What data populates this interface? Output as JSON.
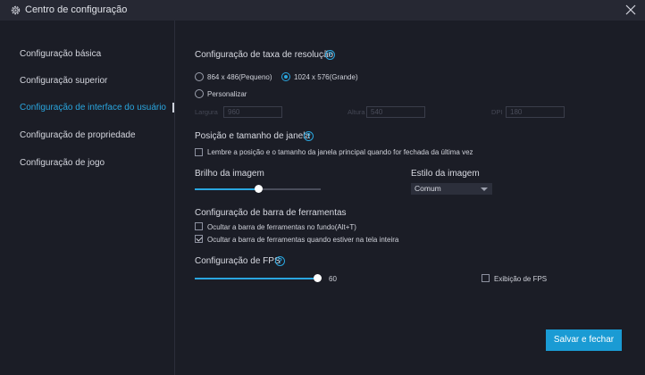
{
  "window": {
    "title": "Centro de configuração",
    "icon": "gear-icon",
    "close_icon": "close-icon"
  },
  "sidebar": {
    "items": [
      {
        "label": "Configuração básica",
        "active": false
      },
      {
        "label": "Configuração superior",
        "active": false
      },
      {
        "label": "Configuração de interface do usuário",
        "active": true
      },
      {
        "label": "Configuração de propriedade",
        "active": false
      },
      {
        "label": "Configuração de jogo",
        "active": false
      }
    ]
  },
  "resolution": {
    "title": "Configuração de taxa de resolução",
    "options": [
      {
        "label": "864 x 486(Pequeno)",
        "selected": false
      },
      {
        "label": "1024 x 576(Grande)",
        "selected": true
      },
      {
        "label": "Personalizar",
        "selected": false
      }
    ],
    "fields": [
      {
        "label": "Largura",
        "value": "960"
      },
      {
        "label": "Altura",
        "value": "540"
      },
      {
        "label": "DPI",
        "value": "180"
      }
    ]
  },
  "position": {
    "title": "Posição e tamanho de janela",
    "remember_label": "Lembre a posição e o tamanho da janela principal quando for fechada da última vez",
    "remember_checked": false
  },
  "brightness": {
    "title": "Brilho da imagem",
    "level_fraction": 0.5
  },
  "image_style": {
    "title": "Estilo da imagem",
    "selected": "Comum"
  },
  "toolbar": {
    "title": "Configuração de barra de ferramentas",
    "options": [
      {
        "label": "Ocultar a barra de ferramentas no fundo(Alt+T)",
        "checked": false
      },
      {
        "label": "Ocultar a barra de ferramentas quando estiver na tela inteira",
        "checked": true
      }
    ]
  },
  "fps": {
    "title": "Configuração de FPS",
    "value": "60",
    "level_fraction": 1.0,
    "show_label": "Exibição de FPS",
    "show_checked": false
  },
  "footer": {
    "save_label": "Salvar e fechar"
  },
  "colors": {
    "accent": "#2aa6df",
    "background": "#1b1d26",
    "titlebar": "#262833",
    "button": "#1a9bd4"
  }
}
